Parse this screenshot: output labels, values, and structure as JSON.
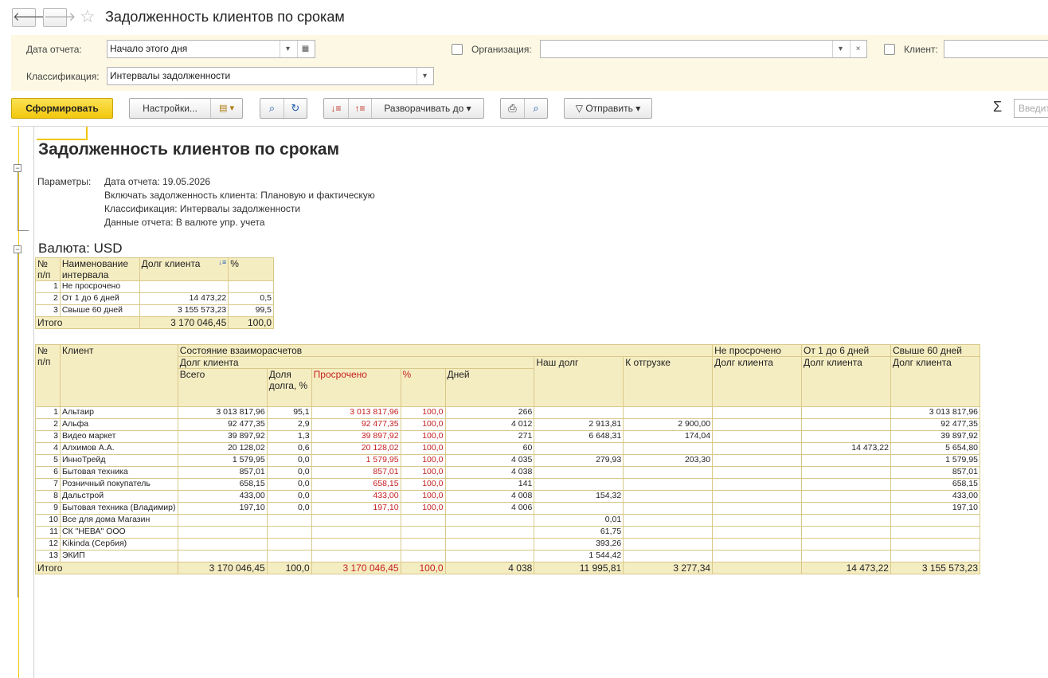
{
  "window": {
    "title": "Задолженность клиентов по срокам",
    "back": "🡐",
    "forward": "🡒"
  },
  "filters": {
    "date_label": "Дата отчета:",
    "date_value": "Начало этого дня",
    "org_label": "Организация:",
    "org_value": "",
    "client_label": "Клиент:",
    "class_label": "Классификация:",
    "class_value": "Интервалы задолженности"
  },
  "toolbar": {
    "generate": "Сформировать",
    "settings": "Настройки...",
    "expand_to": "Разворачивать до",
    "send": "Отправить",
    "sigma": "Σ",
    "search_placeholder": "Введите"
  },
  "report": {
    "title": "Задолженность клиентов по срокам",
    "params_label": "Параметры:",
    "params": [
      "Дата отчета: 19.05.2026",
      "Включать задолженность клиента: Плановую и фактическую",
      "Классификация: Интервалы задолженности",
      "Данные отчета: В валюте упр. учета"
    ],
    "currency": "Валюта: USD"
  },
  "summary": {
    "headers": {
      "num": "№ п/п",
      "name": "Наименование интервала",
      "debt": "Долг клиента",
      "pct": "%"
    },
    "rows": [
      {
        "n": "1",
        "name": "Не просрочено",
        "debt": "",
        "pct": ""
      },
      {
        "n": "2",
        "name": "От 1 до 6 дней",
        "debt": "14 473,22",
        "pct": "0,5"
      },
      {
        "n": "3",
        "name": "Свыше 60 дней",
        "debt": "3 155 573,23",
        "pct": "99,5"
      }
    ],
    "total": {
      "label": "Итого",
      "debt": "3 170 046,45",
      "pct": "100,0"
    }
  },
  "main": {
    "headers": {
      "num": "№ п/п",
      "client": "Клиент",
      "state": "Состояние взаиморасчетов",
      "client_debt": "Долг клиента",
      "total": "Всего",
      "share": "Доля долга, %",
      "overdue": "Просрочено",
      "pct": "%",
      "days": "Дней",
      "our_debt": "Наш долг",
      "to_ship": "К отгрузке",
      "not_overdue": "Не просрочено",
      "d1_6": "От 1 до 6 дней",
      "over60": "Свыше 60 дней",
      "sub_debt": "Долг клиента"
    },
    "rows": [
      {
        "n": "1",
        "client": "Альтаир",
        "total": "3 013 817,96",
        "share": "95,1",
        "overdue": "3 013 817,96",
        "pct": "100,0",
        "days": "266",
        "our": "",
        "ship": "",
        "notover": "",
        "d16": "",
        "d60": "3 013 817,96"
      },
      {
        "n": "2",
        "client": "Альфа",
        "total": "92 477,35",
        "share": "2,9",
        "overdue": "92 477,35",
        "pct": "100,0",
        "days": "4 012",
        "our": "2 913,81",
        "ship": "2 900,00",
        "notover": "",
        "d16": "",
        "d60": "92 477,35"
      },
      {
        "n": "3",
        "client": "Видео маркет",
        "total": "39 897,92",
        "share": "1,3",
        "overdue": "39 897,92",
        "pct": "100,0",
        "days": "271",
        "our": "6 648,31",
        "ship": "174,04",
        "notover": "",
        "d16": "",
        "d60": "39 897,92"
      },
      {
        "n": "4",
        "client": "Алхимов А.А.",
        "total": "20 128,02",
        "share": "0,6",
        "overdue": "20 128,02",
        "pct": "100,0",
        "days": "60",
        "our": "",
        "ship": "",
        "notover": "",
        "d16": "14 473,22",
        "d60": "5 654,80"
      },
      {
        "n": "5",
        "client": "ИнноТрейд",
        "total": "1 579,95",
        "share": "0,0",
        "overdue": "1 579,95",
        "pct": "100,0",
        "days": "4 035",
        "our": "279,93",
        "ship": "203,30",
        "notover": "",
        "d16": "",
        "d60": "1 579,95"
      },
      {
        "n": "6",
        "client": "Бытовая техника",
        "total": "857,01",
        "share": "0,0",
        "overdue": "857,01",
        "pct": "100,0",
        "days": "4 038",
        "our": "",
        "ship": "",
        "notover": "",
        "d16": "",
        "d60": "857,01"
      },
      {
        "n": "7",
        "client": "Розничный покупатель",
        "total": "658,15",
        "share": "0,0",
        "overdue": "658,15",
        "pct": "100,0",
        "days": "141",
        "our": "",
        "ship": "",
        "notover": "",
        "d16": "",
        "d60": "658,15"
      },
      {
        "n": "8",
        "client": "Дальстрой",
        "total": "433,00",
        "share": "0,0",
        "overdue": "433,00",
        "pct": "100,0",
        "days": "4 008",
        "our": "154,32",
        "ship": "",
        "notover": "",
        "d16": "",
        "d60": "433,00"
      },
      {
        "n": "9",
        "client": "Бытовая техника (Владимир)",
        "total": "197,10",
        "share": "0,0",
        "overdue": "197,10",
        "pct": "100,0",
        "days": "4 006",
        "our": "",
        "ship": "",
        "notover": "",
        "d16": "",
        "d60": "197,10"
      },
      {
        "n": "10",
        "client": "Все для дома Магазин",
        "total": "",
        "share": "",
        "overdue": "",
        "pct": "",
        "days": "",
        "our": "0,01",
        "ship": "",
        "notover": "",
        "d16": "",
        "d60": ""
      },
      {
        "n": "11",
        "client": "СК \"НЕВА\" ООО",
        "total": "",
        "share": "",
        "overdue": "",
        "pct": "",
        "days": "",
        "our": "61,75",
        "ship": "",
        "notover": "",
        "d16": "",
        "d60": ""
      },
      {
        "n": "12",
        "client": "Kikinda (Сербия)",
        "total": "",
        "share": "",
        "overdue": "",
        "pct": "",
        "days": "",
        "our": "393,26",
        "ship": "",
        "notover": "",
        "d16": "",
        "d60": ""
      },
      {
        "n": "13",
        "client": "ЭКИП",
        "total": "",
        "share": "",
        "overdue": "",
        "pct": "",
        "days": "",
        "our": "1 544,42",
        "ship": "",
        "notover": "",
        "d16": "",
        "d60": ""
      }
    ],
    "total": {
      "label": "Итого",
      "total": "3 170 046,45",
      "share": "100,0",
      "overdue": "3 170 046,45",
      "pct": "100,0",
      "days": "4 038",
      "our": "11 995,81",
      "ship": "3 277,34",
      "notover": "",
      "d16": "14 473,22",
      "d60": "3 155 573,23"
    }
  }
}
